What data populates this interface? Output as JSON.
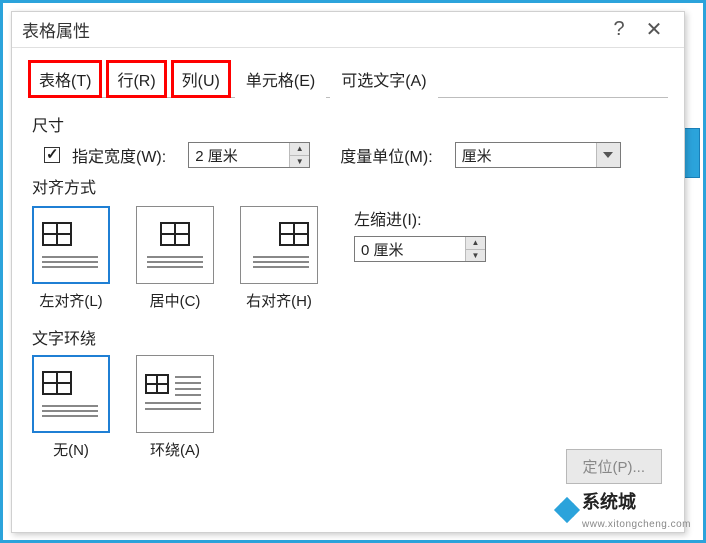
{
  "titlebar": {
    "title": "表格属性",
    "help": "?",
    "close": "✕"
  },
  "tabs": {
    "table": "表格(T)",
    "row": "行(R)",
    "column": "列(U)",
    "cell": "单元格(E)",
    "alttext": "可选文字(A)"
  },
  "size": {
    "group": "尺寸",
    "specify_width": "指定宽度(W):",
    "width_value": "2 厘米",
    "unit_label": "度量单位(M):",
    "unit_value": "厘米"
  },
  "align": {
    "group": "对齐方式",
    "left": "左对齐(L)",
    "center": "居中(C)",
    "right": "右对齐(H)",
    "indent_label": "左缩进(I):",
    "indent_value": "0 厘米"
  },
  "wrap": {
    "group": "文字环绕",
    "none": "无(N)",
    "around": "环绕(A)"
  },
  "buttons": {
    "position": "定位(P)..."
  },
  "watermark": {
    "brand": "系统城",
    "sub": "www.xitongcheng.com"
  }
}
